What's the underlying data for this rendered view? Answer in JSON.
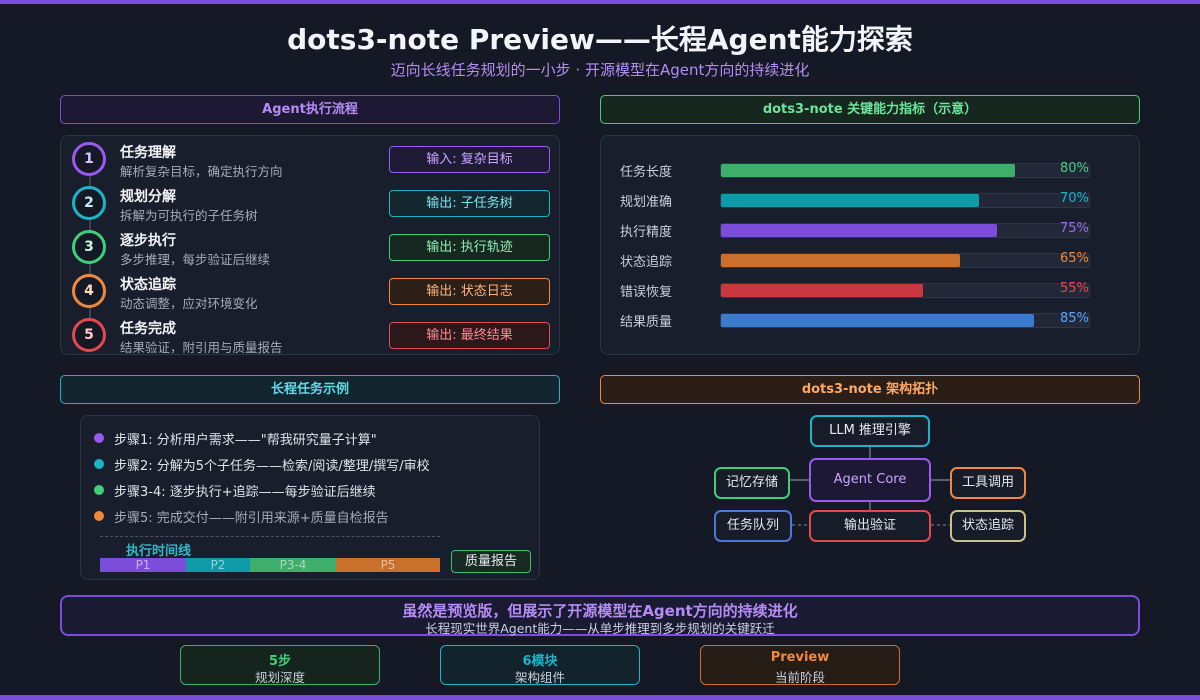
{
  "header": {
    "title": "dots3-note Preview——长程Agent能力探索",
    "subtitle": "迈向长线任务规划的一小步 · 开源模型在Agent方向的持续进化"
  },
  "flow": {
    "heading": "Agent执行流程",
    "steps": [
      {
        "num": "1",
        "title": "任务理解",
        "desc": "解析复杂目标，确定执行方向",
        "tag": "输入: 复杂目标",
        "color": "#9b59f0"
      },
      {
        "num": "2",
        "title": "规划分解",
        "desc": "拆解为可执行的子任务树",
        "tag": "输出: 子任务树",
        "color": "#18b6c8"
      },
      {
        "num": "3",
        "title": "逐步执行",
        "desc": "多步推理，每步验证后继续",
        "tag": "输出: 执行轨迹",
        "color": "#3fcf7a"
      },
      {
        "num": "4",
        "title": "状态追踪",
        "desc": "动态调整，应对环境变化",
        "tag": "输出: 状态日志",
        "color": "#f0883e"
      },
      {
        "num": "5",
        "title": "任务完成",
        "desc": "结果验证，附引用与质量报告",
        "tag": "输出: 最终结果",
        "color": "#e5484d"
      }
    ]
  },
  "metrics": {
    "heading": "dots3-note 关键能力指标（示意）",
    "items": [
      {
        "label": "任务长度",
        "value": 80,
        "text": "80%",
        "color": "#3fae6a",
        "text_color": "#3fcf7a"
      },
      {
        "label": "规划准确",
        "value": 70,
        "text": "70%",
        "color": "#0f9aaa",
        "text_color": "#18b6c8"
      },
      {
        "label": "执行精度",
        "value": 75,
        "text": "75%",
        "color": "#7c4ddb",
        "text_color": "#9b6cf0"
      },
      {
        "label": "状态追踪",
        "value": 65,
        "text": "65%",
        "color": "#c8702c",
        "text_color": "#f0883e"
      },
      {
        "label": "错误恢复",
        "value": 55,
        "text": "55%",
        "color": "#c8383e",
        "text_color": "#e5484d"
      },
      {
        "label": "结果质量",
        "value": 85,
        "text": "85%",
        "color": "#3a7bd0",
        "text_color": "#58a6ff"
      }
    ]
  },
  "example": {
    "heading": "长程任务示例",
    "items": [
      {
        "text": "步骤1: 分析用户需求——\"帮我研究量子计算\"",
        "color": "#9b59f0"
      },
      {
        "text": "步骤2: 分解为5个子任务——检索/阅读/整理/撰写/审校",
        "color": "#18b6c8"
      },
      {
        "text": "步骤3-4: 逐步执行+追踪——每步验证后继续",
        "color": "#3fcf7a"
      },
      {
        "text": "步骤5: 完成交付——附引用来源+质量自检报告",
        "color": "#f0883e"
      }
    ],
    "timeline_label": "执行时间线",
    "segments": [
      {
        "label": "P1",
        "color": "#7c4ddb"
      },
      {
        "label": "P2",
        "color": "#0f9aaa"
      },
      {
        "label": "P3-4",
        "color": "#3fae6a"
      },
      {
        "label": "P5",
        "color": "#c8702c"
      }
    ],
    "report_label": "质量报告"
  },
  "arch": {
    "heading": "dots3-note 架构拓扑",
    "nodes": {
      "llm": "LLM 推理引擎",
      "core": "Agent Core",
      "memory": "记忆存储",
      "tools": "工具调用",
      "queue": "任务队列",
      "verify": "输出验证",
      "state": "状态追踪"
    }
  },
  "banner": {
    "main": "虽然是预览版，但展示了开源模型在Agent方向的持续进化",
    "sub": "长程现实世界Agent能力——从单步推理到多步规划的关键跃迁"
  },
  "stats": [
    {
      "value": "5步",
      "label": "规划深度",
      "color": "#3fcf7a"
    },
    {
      "value": "6模块",
      "label": "架构组件",
      "color": "#18b6c8"
    },
    {
      "value": "Preview",
      "label": "当前阶段",
      "color": "#f0883e"
    }
  ]
}
